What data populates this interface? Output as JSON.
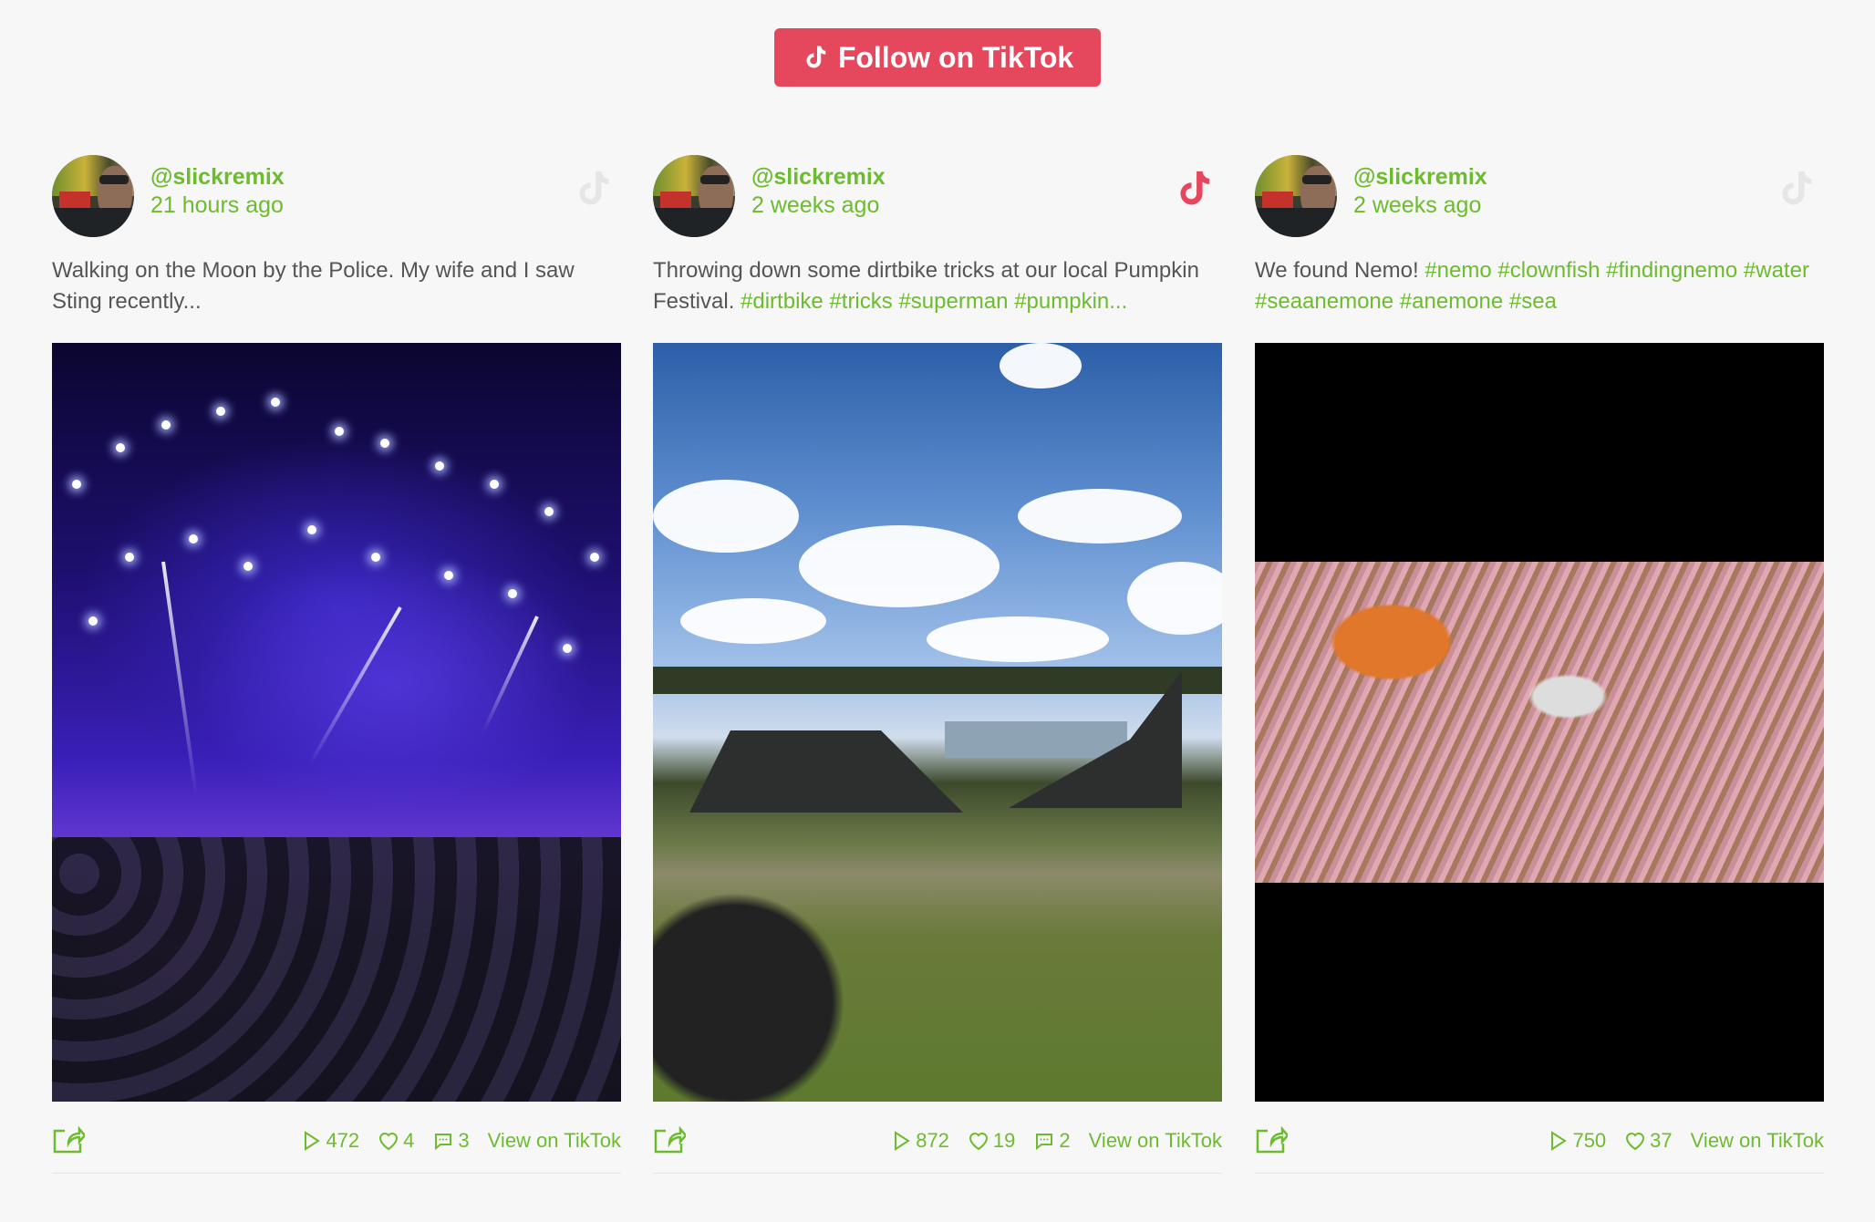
{
  "follow_button": {
    "label": "Follow on TikTok",
    "icon": "tiktok-icon"
  },
  "colors": {
    "accent": "#6dbb2f",
    "brand": "#e5485d",
    "text": "#555555",
    "icon_muted": "#e4e4e4"
  },
  "posts": [
    {
      "username": "@slickremix",
      "time_ago": "21 hours ago",
      "caption": [
        {
          "text": "Walking on the Moon by the Police. My wife and I saw Sting recently...",
          "tag": false
        }
      ],
      "media": "concert stage with purple lights",
      "tiktok_icon_active": false,
      "stats": {
        "plays": "472",
        "likes": "4",
        "comments": "3"
      },
      "view_label": "View on TikTok"
    },
    {
      "username": "@slickremix",
      "time_ago": "2 weeks ago",
      "caption": [
        {
          "text": "Throwing down some dirtbike tricks at our local Pumpkin Festival. ",
          "tag": false
        },
        {
          "text": "#dirtbike",
          "tag": true
        },
        {
          "text": " ",
          "tag": false
        },
        {
          "text": "#tricks",
          "tag": true
        },
        {
          "text": " ",
          "tag": false
        },
        {
          "text": "#superman",
          "tag": true
        },
        {
          "text": " ",
          "tag": false
        },
        {
          "text": "#pumpkin...",
          "tag": true
        }
      ],
      "media": "dirtbike ramp in grassy field under blue sky",
      "tiktok_icon_active": true,
      "stats": {
        "plays": "872",
        "likes": "19",
        "comments": "2"
      },
      "view_label": "View on TikTok"
    },
    {
      "username": "@slickremix",
      "time_ago": "2 weeks ago",
      "caption": [
        {
          "text": "We found Nemo! ",
          "tag": false
        },
        {
          "text": "#nemo",
          "tag": true
        },
        {
          "text": " ",
          "tag": false
        },
        {
          "text": "#clownfish",
          "tag": true
        },
        {
          "text": " ",
          "tag": false
        },
        {
          "text": "#findingnemo",
          "tag": true
        },
        {
          "text": " ",
          "tag": false
        },
        {
          "text": "#water",
          "tag": true
        },
        {
          "text": " ",
          "tag": false
        },
        {
          "text": "#seaanemone",
          "tag": true
        },
        {
          "text": " ",
          "tag": false
        },
        {
          "text": "#anemone",
          "tag": true
        },
        {
          "text": " ",
          "tag": false
        },
        {
          "text": "#sea",
          "tag": true
        }
      ],
      "media": "clownfish in sea anemone",
      "tiktok_icon_active": false,
      "stats": {
        "plays": "750",
        "likes": "37",
        "comments": null
      },
      "view_label": "View on TikTok"
    }
  ]
}
